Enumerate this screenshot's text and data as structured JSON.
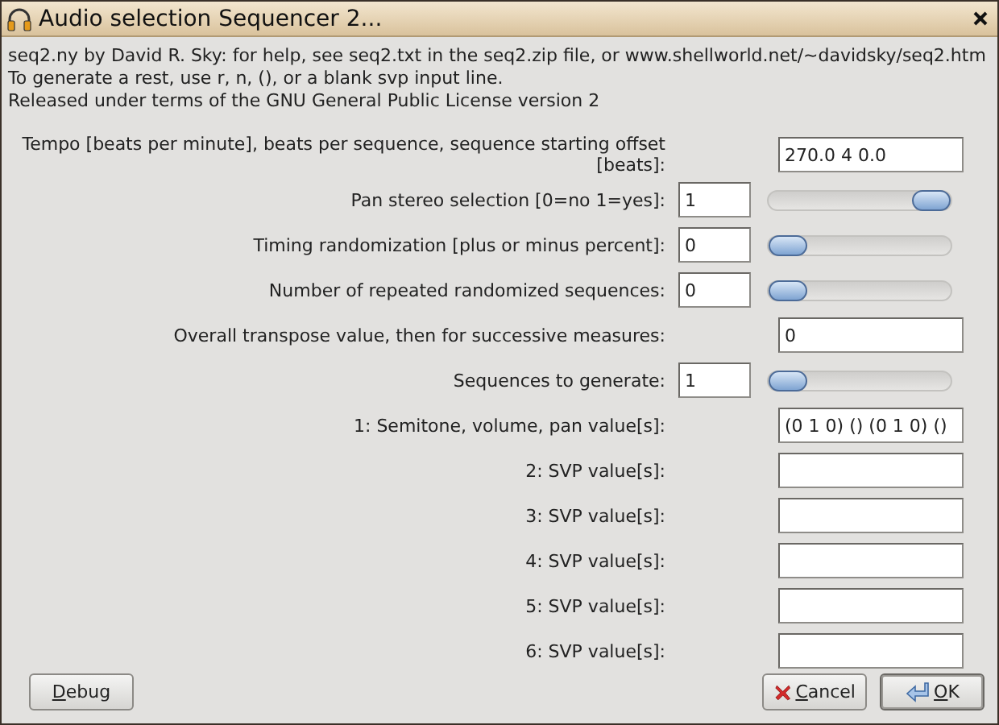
{
  "window": {
    "title": "Audio selection Sequencer 2..."
  },
  "info": [
    "seq2.ny by David R. Sky: for help, see seq2.txt in the seq2.zip file, or www.shellworld.net/~davidsky/seq2.htm",
    "To generate a rest, use r, n, (),  or a blank svp input line.",
    "Released under terms of the GNU General Public License version 2"
  ],
  "rows": [
    {
      "kind": "text",
      "label": "Tempo [beats per minute], beats per sequence, sequence starting offset [beats]:",
      "value": "270.0 4 0.0"
    },
    {
      "kind": "slider",
      "label": "Pan stereo selection [0=no 1=yes]:",
      "value": "1",
      "level": 1
    },
    {
      "kind": "slider",
      "label": "Timing randomization [plus or minus percent]:",
      "value": "0",
      "level": 0
    },
    {
      "kind": "slider",
      "label": "Number of repeated randomized sequences:",
      "value": "0",
      "level": 0
    },
    {
      "kind": "text",
      "label": "Overall transpose value, then for successive measures:",
      "value": "0"
    },
    {
      "kind": "slider",
      "label": "Sequences to generate:",
      "value": "1",
      "level": 0
    },
    {
      "kind": "text",
      "label": "1: Semitone, volume, pan value[s]:",
      "value": "(0 1 0) () (0 1 0) ()"
    },
    {
      "kind": "text",
      "label": "2: SVP value[s]:"
    },
    {
      "kind": "text",
      "label": "3: SVP value[s]:"
    },
    {
      "kind": "text",
      "label": "4: SVP value[s]:"
    },
    {
      "kind": "text",
      "label": "5: SVP value[s]:"
    },
    {
      "kind": "text",
      "label": "6: SVP value[s]:"
    }
  ],
  "buttons": [
    {
      "kind": "debug",
      "label": "Debug"
    },
    {
      "kind": "cancel",
      "label": "Cancel"
    },
    {
      "kind": "ok",
      "label": "OK"
    }
  ]
}
